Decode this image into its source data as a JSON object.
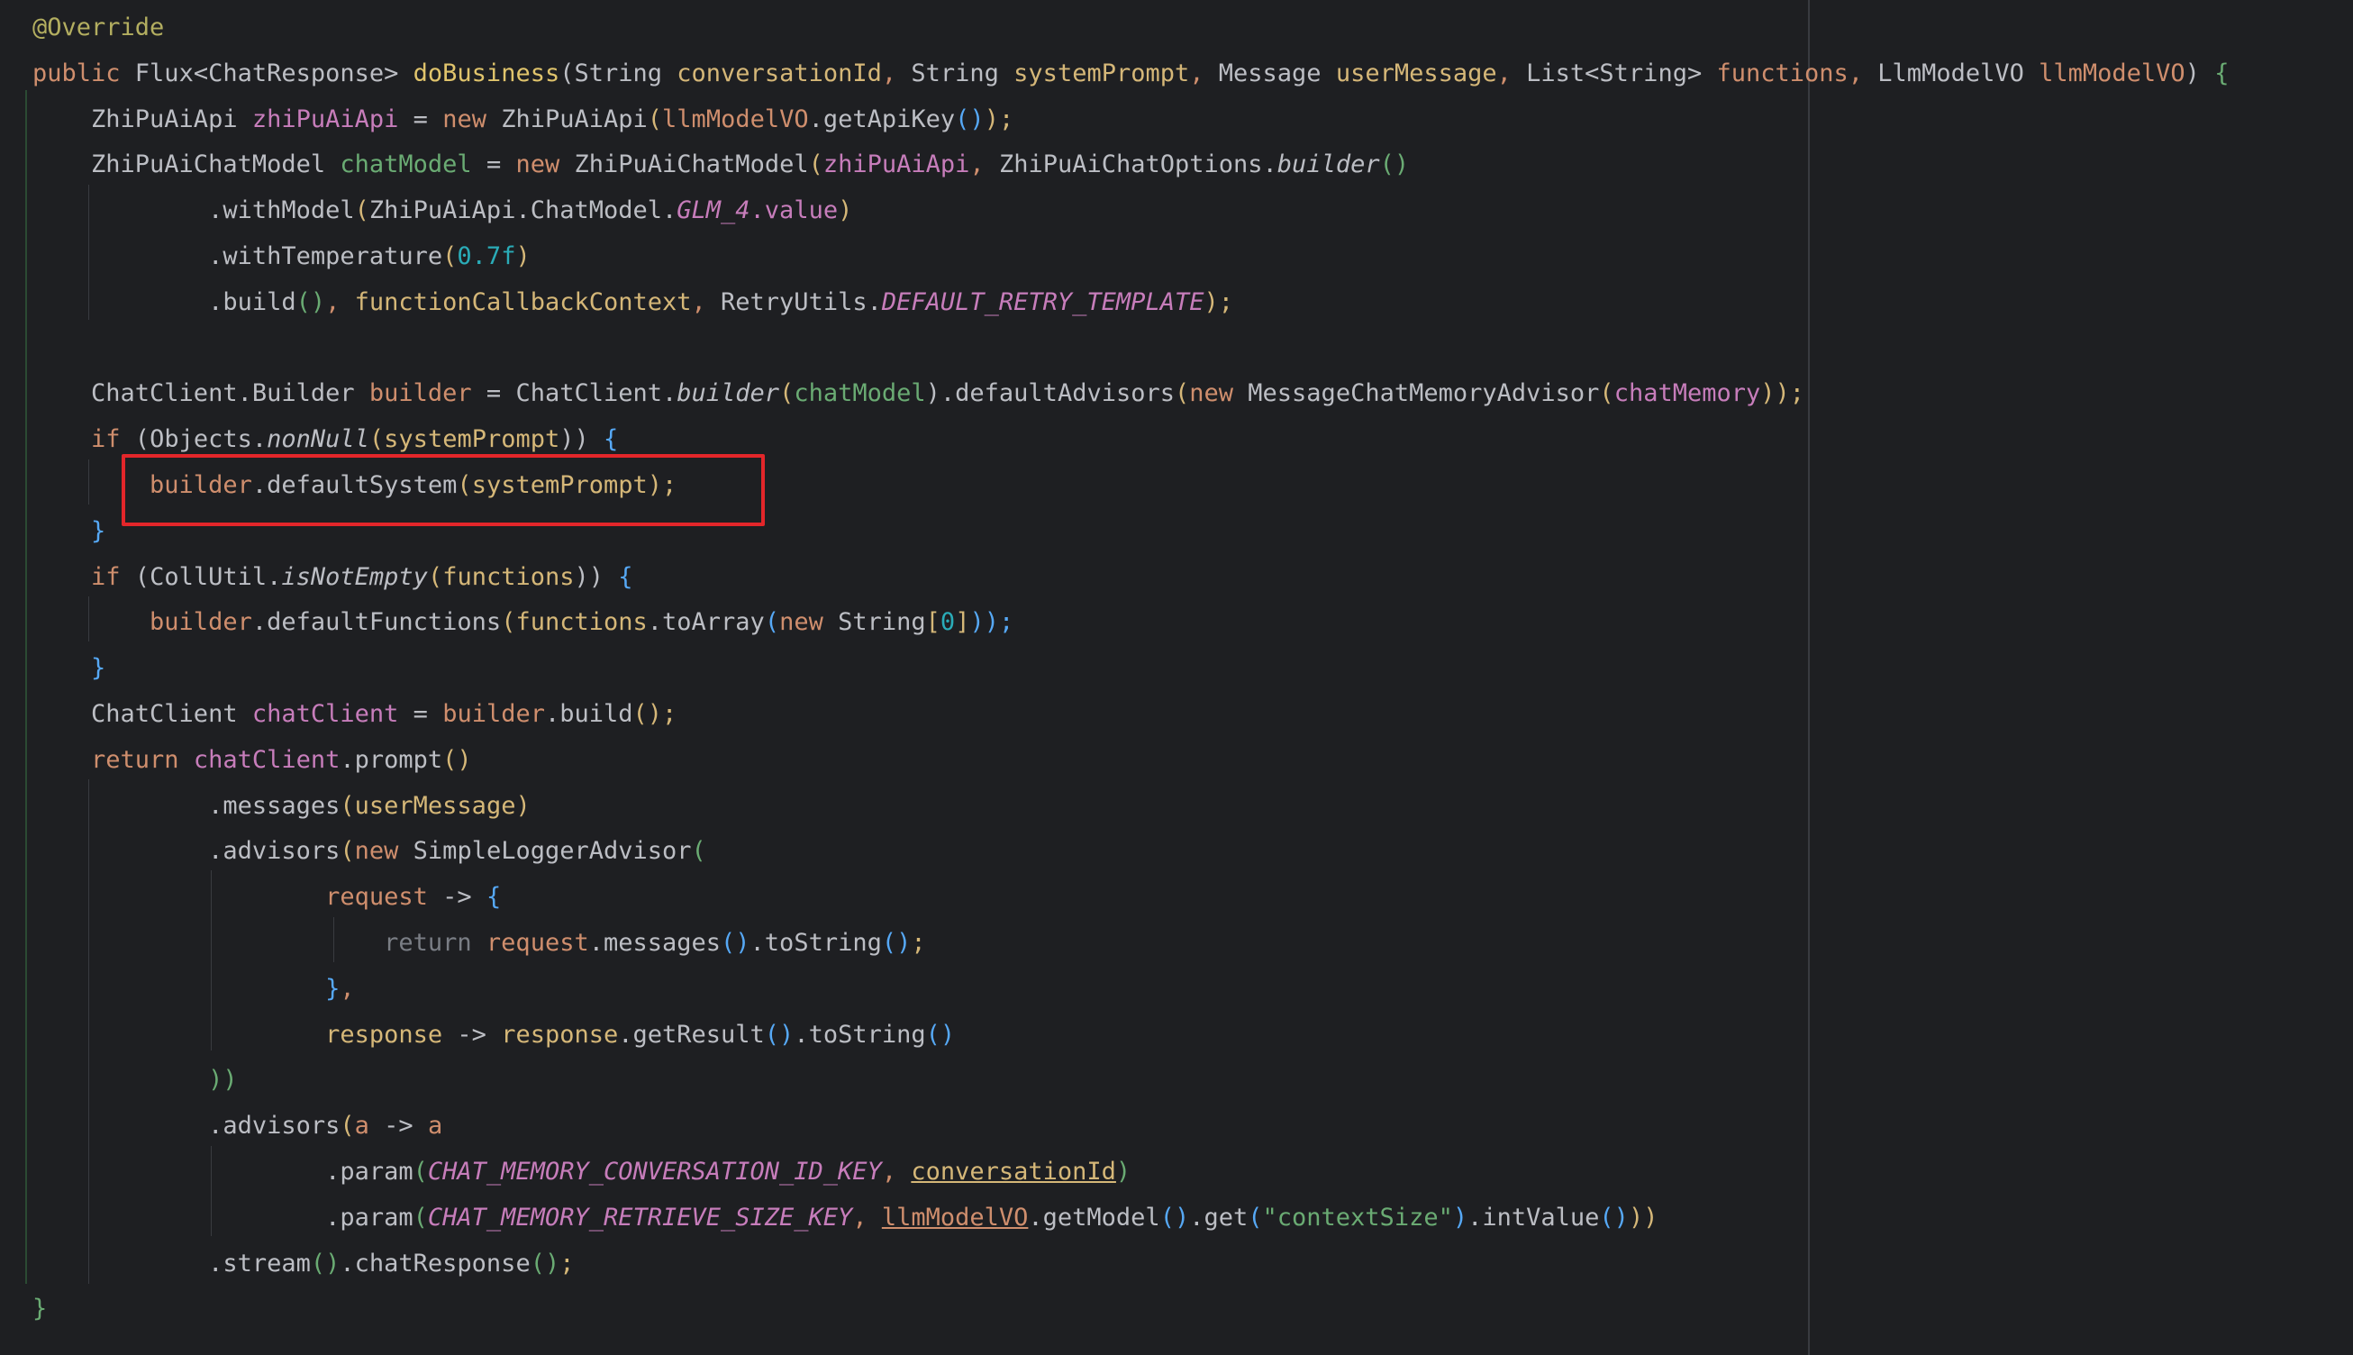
{
  "editor": {
    "theme_colors": {
      "background": "#1e1f22",
      "keyword": "#cf8e6d",
      "method_declaration": "#e0c46c",
      "string": "#6aab73",
      "number": "#2aacb8",
      "highlight_box": "#e3262a"
    },
    "code_lines": [
      [
        [
          "@Override",
          "t-ann"
        ]
      ],
      [
        [
          "public ",
          "t-kw"
        ],
        [
          "Flux<ChatResponse> ",
          "t-type"
        ],
        [
          "doBusiness",
          "t-decl"
        ],
        [
          "(",
          "t-plain"
        ],
        [
          "String ",
          "t-type"
        ],
        [
          "conversationId",
          "t-lam"
        ],
        [
          ", ",
          "t-kw"
        ],
        [
          "String ",
          "t-type"
        ],
        [
          "systemPrompt",
          "t-lam"
        ],
        [
          ", ",
          "t-kw"
        ],
        [
          "Message ",
          "t-type"
        ],
        [
          "userMessage",
          "t-lam"
        ],
        [
          ", ",
          "t-kw"
        ],
        [
          "List<String> ",
          "t-type"
        ],
        [
          "functions",
          "t-kw"
        ],
        [
          ", ",
          "t-kw"
        ],
        [
          "LlmModelVO ",
          "t-type"
        ],
        [
          "llmModelVO",
          "t-kw"
        ],
        [
          ") ",
          "t-plain"
        ],
        [
          "{",
          "t-green"
        ]
      ],
      [
        [
          "    ZhiPuAiApi ",
          "t-type"
        ],
        [
          "zhiPuAiApi",
          "t-pink"
        ],
        [
          " = ",
          "t-plain"
        ],
        [
          "new ",
          "t-kw"
        ],
        [
          "ZhiPuAiApi",
          "t-type"
        ],
        [
          "(",
          "t-lam"
        ],
        [
          "llmModelVO",
          "t-kw"
        ],
        [
          ".getApiKey",
          "t-plain"
        ],
        [
          "()",
          "t-fn"
        ],
        [
          ");",
          "t-lam"
        ]
      ],
      [
        [
          "    ZhiPuAiChatModel ",
          "t-type"
        ],
        [
          "chatModel",
          "t-green"
        ],
        [
          " = ",
          "t-plain"
        ],
        [
          "new ",
          "t-kw"
        ],
        [
          "ZhiPuAiChatModel",
          "t-type"
        ],
        [
          "(",
          "t-lam"
        ],
        [
          "zhiPuAiApi",
          "t-pink"
        ],
        [
          ", ",
          "t-kw"
        ],
        [
          "ZhiPuAiChatOptions.",
          "t-type"
        ],
        [
          "builder",
          "t-static"
        ],
        [
          "()",
          "t-green"
        ]
      ],
      [
        [
          "            .withModel",
          "t-plain"
        ],
        [
          "(",
          "t-lam"
        ],
        [
          "ZhiPuAiApi.ChatModel.",
          "t-type"
        ],
        [
          "GLM_4",
          "t-const"
        ],
        [
          ".value",
          "t-pink"
        ],
        [
          ")",
          "t-lam"
        ]
      ],
      [
        [
          "            .withTemperature",
          "t-plain"
        ],
        [
          "(",
          "t-lam"
        ],
        [
          "0.7f",
          "t-num"
        ],
        [
          ")",
          "t-lam"
        ]
      ],
      [
        [
          "            .build",
          "t-plain"
        ],
        [
          "()",
          "t-green"
        ],
        [
          ", ",
          "t-kw"
        ],
        [
          "functionCallbackContext",
          "t-lam"
        ],
        [
          ", ",
          "t-kw"
        ],
        [
          "RetryUtils.",
          "t-type"
        ],
        [
          "DEFAULT_RETRY_TEMPLATE",
          "t-const"
        ],
        [
          ");",
          "t-lam"
        ]
      ],
      [
        [
          "",
          "t-plain"
        ]
      ],
      [
        [
          "    ChatClient.Builder ",
          "t-type"
        ],
        [
          "builder",
          "t-kw"
        ],
        [
          " = ",
          "t-plain"
        ],
        [
          "ChatClient.",
          "t-type"
        ],
        [
          "builder",
          "t-static"
        ],
        [
          "(",
          "t-lam"
        ],
        [
          "chatModel",
          "t-green"
        ],
        [
          ").defaultAdvisors",
          "t-plain"
        ],
        [
          "(",
          "t-lam"
        ],
        [
          "new ",
          "t-kw"
        ],
        [
          "MessageChatMemoryAdvisor",
          "t-type"
        ],
        [
          "(",
          "t-lam"
        ],
        [
          "chatMemory",
          "t-pink"
        ],
        [
          "));",
          "t-lam"
        ]
      ],
      [
        [
          "    if ",
          "t-kw"
        ],
        [
          "(",
          "t-plain"
        ],
        [
          "Objects.",
          "t-type"
        ],
        [
          "nonNull",
          "t-static"
        ],
        [
          "(",
          "t-lam"
        ],
        [
          "systemPrompt",
          "t-lam"
        ],
        [
          ")) ",
          "t-plain"
        ],
        [
          "{",
          "t-fn"
        ]
      ],
      [
        [
          "        builder",
          "t-kw"
        ],
        [
          ".defaultSystem",
          "t-plain"
        ],
        [
          "(",
          "t-lam"
        ],
        [
          "systemPrompt",
          "t-lam"
        ],
        [
          ");",
          "t-lam"
        ]
      ],
      [
        [
          "    }",
          "t-fn"
        ]
      ],
      [
        [
          "    if ",
          "t-kw"
        ],
        [
          "(",
          "t-plain"
        ],
        [
          "CollUtil.",
          "t-type"
        ],
        [
          "isNotEmpty",
          "t-static"
        ],
        [
          "(",
          "t-lam"
        ],
        [
          "functions",
          "t-lam"
        ],
        [
          ")) ",
          "t-plain"
        ],
        [
          "{",
          "t-fn"
        ]
      ],
      [
        [
          "        builder",
          "t-kw"
        ],
        [
          ".defaultFunctions",
          "t-plain"
        ],
        [
          "(",
          "t-lam"
        ],
        [
          "functions",
          "t-lam"
        ],
        [
          ".toArray",
          "t-plain"
        ],
        [
          "(",
          "t-fn"
        ],
        [
          "new ",
          "t-kw"
        ],
        [
          "String",
          "t-type"
        ],
        [
          "[",
          "t-lam"
        ],
        [
          "0",
          "t-num"
        ],
        [
          "]",
          "t-lam"
        ],
        [
          "));",
          "t-fn"
        ]
      ],
      [
        [
          "    }",
          "t-fn"
        ]
      ],
      [
        [
          "    ChatClient ",
          "t-type"
        ],
        [
          "chatClient",
          "t-pink"
        ],
        [
          " = ",
          "t-plain"
        ],
        [
          "builder",
          "t-kw"
        ],
        [
          ".build",
          "t-plain"
        ],
        [
          "()",
          "t-lam"
        ],
        [
          ";",
          "t-lam"
        ]
      ],
      [
        [
          "    return ",
          "t-kw"
        ],
        [
          "chatClient",
          "t-pink"
        ],
        [
          ".prompt",
          "t-plain"
        ],
        [
          "()",
          "t-lam"
        ]
      ],
      [
        [
          "            .messages",
          "t-plain"
        ],
        [
          "(",
          "t-lam"
        ],
        [
          "userMessage",
          "t-lam"
        ],
        [
          ")",
          "t-lam"
        ]
      ],
      [
        [
          "            .advisors",
          "t-plain"
        ],
        [
          "(",
          "t-lam"
        ],
        [
          "new ",
          "t-kw"
        ],
        [
          "SimpleLoggerAdvisor",
          "t-type"
        ],
        [
          "(",
          "t-green"
        ]
      ],
      [
        [
          "                    request",
          "t-kw"
        ],
        [
          " -> ",
          "t-plain"
        ],
        [
          "{",
          "t-fn"
        ]
      ],
      [
        [
          "                        return ",
          "t-dim"
        ],
        [
          "request",
          "t-kw"
        ],
        [
          ".messages",
          "t-plain"
        ],
        [
          "()",
          "t-fn"
        ],
        [
          ".toString",
          "t-plain"
        ],
        [
          "()",
          "t-fn"
        ],
        [
          ";",
          "t-lam"
        ]
      ],
      [
        [
          "                    }",
          "t-fn"
        ],
        [
          ",",
          "t-kw"
        ]
      ],
      [
        [
          "                    response",
          "t-lam"
        ],
        [
          " -> ",
          "t-plain"
        ],
        [
          "response",
          "t-lam"
        ],
        [
          ".getResult",
          "t-plain"
        ],
        [
          "()",
          "t-fn"
        ],
        [
          ".toString",
          "t-plain"
        ],
        [
          "()",
          "t-fn"
        ]
      ],
      [
        [
          "            ))",
          "t-green"
        ]
      ],
      [
        [
          "            .advisors",
          "t-plain"
        ],
        [
          "(",
          "t-lam"
        ],
        [
          "a",
          "t-kw"
        ],
        [
          " -> ",
          "t-plain"
        ],
        [
          "a",
          "t-kw"
        ]
      ],
      [
        [
          "                    .param",
          "t-plain"
        ],
        [
          "(",
          "t-green"
        ],
        [
          "CHAT_MEMORY_CONVERSATION_ID_KEY",
          "t-const"
        ],
        [
          ", ",
          "t-kw"
        ],
        [
          "conversationId",
          "t-lam u"
        ],
        [
          ")",
          "t-green"
        ]
      ],
      [
        [
          "                    .param",
          "t-plain"
        ],
        [
          "(",
          "t-green"
        ],
        [
          "CHAT_MEMORY_RETRIEVE_SIZE_KEY",
          "t-const"
        ],
        [
          ", ",
          "t-kw"
        ],
        [
          "llmModelVO",
          "t-kw u"
        ],
        [
          ".getModel",
          "t-plain"
        ],
        [
          "()",
          "t-fn"
        ],
        [
          ".get",
          "t-plain"
        ],
        [
          "(",
          "t-fn"
        ],
        [
          "\"contextSize\"",
          "t-str"
        ],
        [
          ")",
          "t-fn"
        ],
        [
          ".intValue",
          "t-plain"
        ],
        [
          "()",
          "t-fn"
        ],
        [
          "))",
          "t-lam"
        ]
      ],
      [
        [
          "            .stream",
          "t-plain"
        ],
        [
          "()",
          "t-green"
        ],
        [
          ".chatResponse",
          "t-plain"
        ],
        [
          "()",
          "t-green"
        ],
        [
          ";",
          "t-lam"
        ]
      ],
      [
        [
          "}",
          "t-green"
        ]
      ]
    ]
  }
}
